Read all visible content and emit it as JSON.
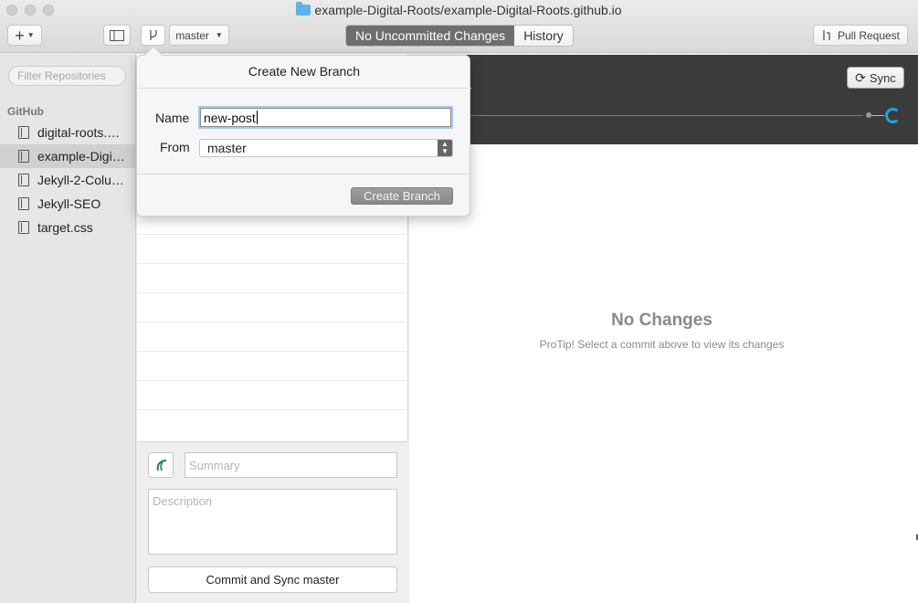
{
  "window": {
    "title": "example-Digital-Roots/example-Digital-Roots.github.io"
  },
  "toolbar": {
    "add_label": "+",
    "branch_name": "master",
    "tabs": [
      {
        "label": "No Uncommitted Changes",
        "active": true
      },
      {
        "label": "History",
        "active": false
      }
    ],
    "pull_request_label": "Pull Request"
  },
  "sidebar": {
    "filter_placeholder": "Filter Repositories",
    "section_title": "GitHub",
    "repos": [
      {
        "label": "digital-roots.github.io",
        "display": "digital-roots.gi…",
        "selected": false
      },
      {
        "label": "example-Digital-Roots.github.io",
        "display": "example-Digit…",
        "selected": true
      },
      {
        "label": "Jekyll-2-Column",
        "display": "Jekyll-2-Colu…",
        "selected": false
      },
      {
        "label": "Jekyll-SEO",
        "display": "Jekyll-SEO",
        "selected": false
      },
      {
        "label": "target.css",
        "display": "target.css",
        "selected": false
      }
    ]
  },
  "commit": {
    "summary_placeholder": "Summary",
    "description_placeholder": "Description",
    "button_label": "Commit and Sync master"
  },
  "history_panel": {
    "sync_label": "Sync",
    "empty_title": "No Changes",
    "empty_hint": "ProTip! Select a commit above to view its changes"
  },
  "popover": {
    "title": "Create New Branch",
    "name_label": "Name",
    "name_value": "new-post",
    "from_label": "From",
    "from_value": "master",
    "create_button": "Create Branch"
  },
  "colors": {
    "accent": "#1da1e6",
    "dark_bar": "#3b3b3b",
    "active_tab": "#6e6e6e"
  }
}
